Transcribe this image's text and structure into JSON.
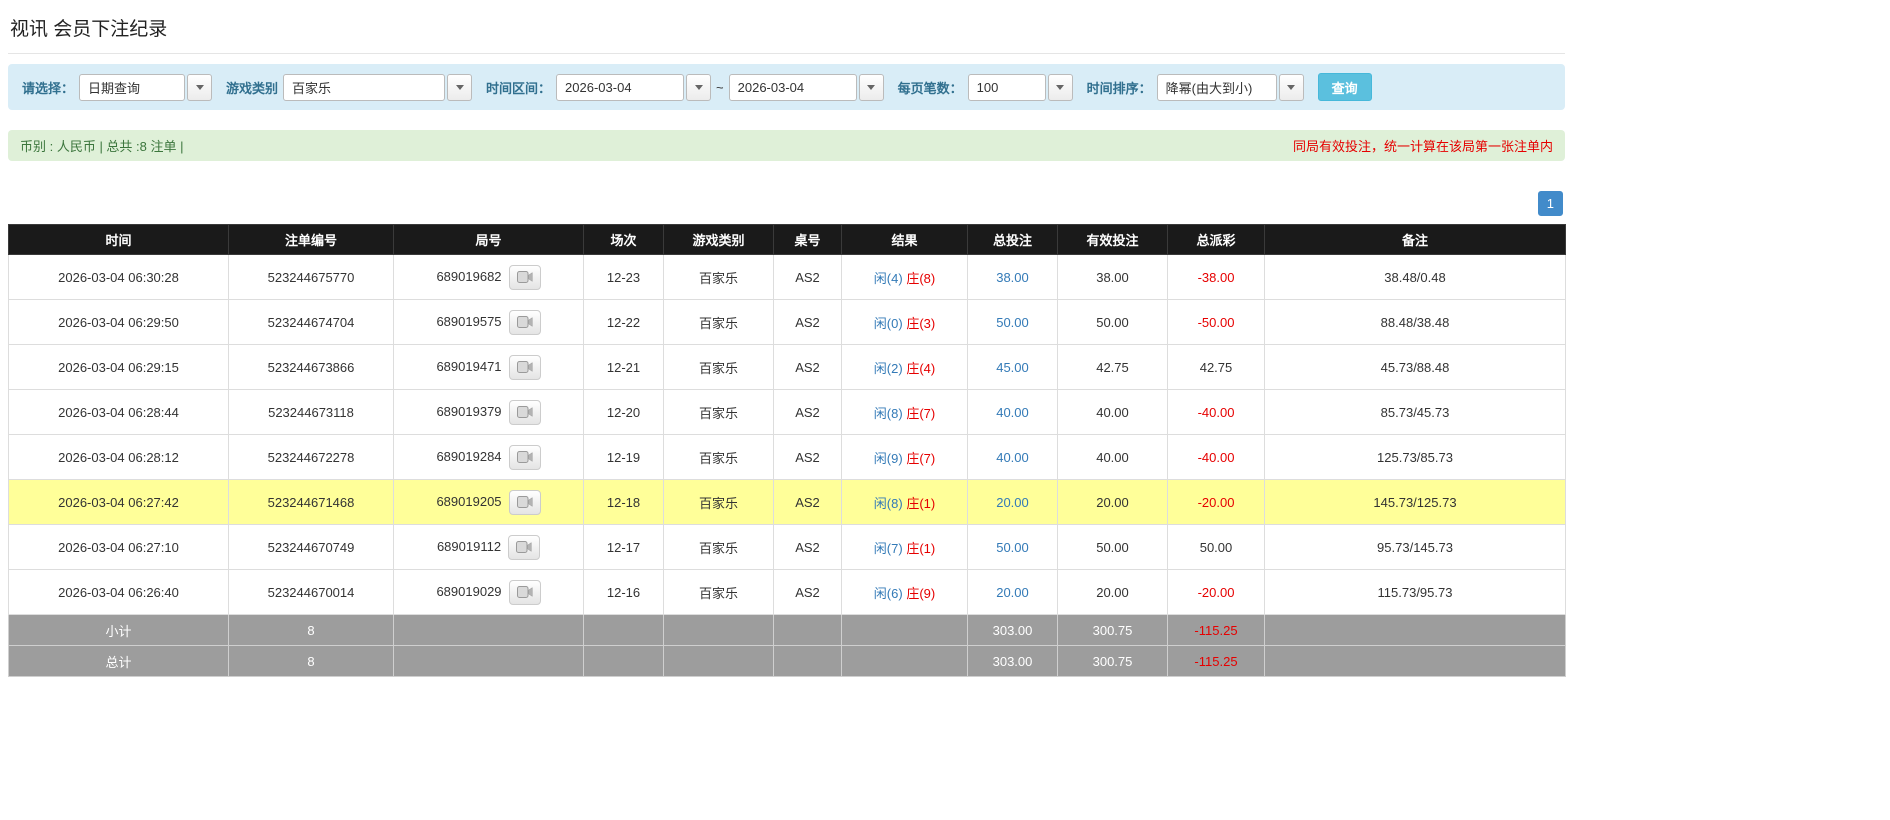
{
  "colors": {
    "accent_blue": "#337ab7",
    "negative_red": "#e60000",
    "highlight_yellow": "#ffff99",
    "header_bg": "#1a1a1a",
    "footer_bg": "#9d9d9d",
    "filter_bg": "#d9edf7",
    "filter_label": "#31708f",
    "info_bg": "#dff0d8",
    "info_text": "#3c763d",
    "search_button_bg": "#5bc0de",
    "pagination_bg": "#428bca"
  },
  "page": {
    "title": "视讯 会员下注纪录"
  },
  "filters": {
    "select_label": "请选择：",
    "select_value": "日期查询",
    "game_type_label": "游戏类别",
    "game_type_value": "百家乐",
    "time_range_label": "时间区间：",
    "date_from": "2026-03-04",
    "date_separator": "~",
    "date_to": "2026-03-04",
    "per_page_label": "每页笔数：",
    "per_page_value": "100",
    "sort_label": "时间排序：",
    "sort_value": "降幂(由大到小)",
    "search_button_label": "查询"
  },
  "info_bar": {
    "summary": "币别 : 人民币 | 总共 :8 注单 |",
    "notice": "同局有效投注，统一计算在该局第一张注单内"
  },
  "pagination": {
    "current_page": "1"
  },
  "table": {
    "headers": [
      "时间",
      "注单编号",
      "局号",
      "场次",
      "游戏类别",
      "桌号",
      "结果",
      "总投注",
      "有效投注",
      "总派彩",
      "备注"
    ],
    "rows": [
      {
        "time": "2026-03-04 06:30:28",
        "bet_id": "523244675770",
        "round_id": "689019682",
        "session": "12-23",
        "game_type": "百家乐",
        "table_no": "AS2",
        "result_player": "闲(4)",
        "result_banker": "庄(8)",
        "total_bet": "38.00",
        "valid_bet": "38.00",
        "payout": "-38.00",
        "remark": "38.48/0.48",
        "highlighted": false
      },
      {
        "time": "2026-03-04 06:29:50",
        "bet_id": "523244674704",
        "round_id": "689019575",
        "session": "12-22",
        "game_type": "百家乐",
        "table_no": "AS2",
        "result_player": "闲(0)",
        "result_banker": "庄(3)",
        "total_bet": "50.00",
        "valid_bet": "50.00",
        "payout": "-50.00",
        "remark": "88.48/38.48",
        "highlighted": false
      },
      {
        "time": "2026-03-04 06:29:15",
        "bet_id": "523244673866",
        "round_id": "689019471",
        "session": "12-21",
        "game_type": "百家乐",
        "table_no": "AS2",
        "result_player": "闲(2)",
        "result_banker": "庄(4)",
        "total_bet": "45.00",
        "valid_bet": "42.75",
        "payout": "42.75",
        "remark": "45.73/88.48",
        "highlighted": false
      },
      {
        "time": "2026-03-04 06:28:44",
        "bet_id": "523244673118",
        "round_id": "689019379",
        "session": "12-20",
        "game_type": "百家乐",
        "table_no": "AS2",
        "result_player": "闲(8)",
        "result_banker": "庄(7)",
        "total_bet": "40.00",
        "valid_bet": "40.00",
        "payout": "-40.00",
        "remark": "85.73/45.73",
        "highlighted": false
      },
      {
        "time": "2026-03-04 06:28:12",
        "bet_id": "523244672278",
        "round_id": "689019284",
        "session": "12-19",
        "game_type": "百家乐",
        "table_no": "AS2",
        "result_player": "闲(9)",
        "result_banker": "庄(7)",
        "total_bet": "40.00",
        "valid_bet": "40.00",
        "payout": "-40.00",
        "remark": "125.73/85.73",
        "highlighted": false
      },
      {
        "time": "2026-03-04 06:27:42",
        "bet_id": "523244671468",
        "round_id": "689019205",
        "session": "12-18",
        "game_type": "百家乐",
        "table_no": "AS2",
        "result_player": "闲(8)",
        "result_banker": "庄(1)",
        "total_bet": "20.00",
        "valid_bet": "20.00",
        "payout": "-20.00",
        "remark": "145.73/125.73",
        "highlighted": true
      },
      {
        "time": "2026-03-04 06:27:10",
        "bet_id": "523244670749",
        "round_id": "689019112",
        "session": "12-17",
        "game_type": "百家乐",
        "table_no": "AS2",
        "result_player": "闲(7)",
        "result_banker": "庄(1)",
        "total_bet": "50.00",
        "valid_bet": "50.00",
        "payout": "50.00",
        "remark": "95.73/145.73",
        "highlighted": false
      },
      {
        "time": "2026-03-04 06:26:40",
        "bet_id": "523244670014",
        "round_id": "689019029",
        "session": "12-16",
        "game_type": "百家乐",
        "table_no": "AS2",
        "result_player": "闲(6)",
        "result_banker": "庄(9)",
        "total_bet": "20.00",
        "valid_bet": "20.00",
        "payout": "-20.00",
        "remark": "115.73/95.73",
        "highlighted": false
      }
    ],
    "summary_rows": [
      {
        "label": "小计",
        "count": "8",
        "total_bet": "303.00",
        "valid_bet": "300.75",
        "payout": "-115.25"
      },
      {
        "label": "总计",
        "count": "8",
        "total_bet": "303.00",
        "valid_bet": "300.75",
        "payout": "-115.25"
      }
    ]
  }
}
